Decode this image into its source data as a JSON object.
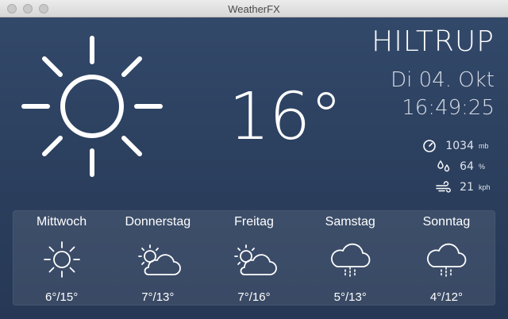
{
  "window": {
    "title": "WeatherFX"
  },
  "current": {
    "icon": "sun-icon",
    "temperature": "16°",
    "city": "HILTRUP",
    "date": "Di 04. Okt",
    "time": "16:49:25",
    "pressure": {
      "icon": "gauge-icon",
      "value": "1034",
      "unit": "mb"
    },
    "humidity": {
      "icon": "humidity-icon",
      "value": "64",
      "unit": "%"
    },
    "wind": {
      "icon": "wind-icon",
      "value": "21",
      "unit": "kph"
    }
  },
  "forecast": [
    {
      "day": "Mittwoch",
      "icon": "sun-icon",
      "range": "6°/15°"
    },
    {
      "day": "Donnerstag",
      "icon": "partly-cloudy-icon",
      "range": "7°/13°"
    },
    {
      "day": "Freitag",
      "icon": "partly-cloudy-icon",
      "range": "7°/16°"
    },
    {
      "day": "Samstag",
      "icon": "rain-cloud-icon",
      "range": "5°/13°"
    },
    {
      "day": "Sonntag",
      "icon": "rain-cloud-icon",
      "range": "4°/12°"
    }
  ],
  "colors": {
    "background": "#2c405f",
    "text": "#ffffff",
    "panel": "rgba(255,255,255,0.09)"
  }
}
